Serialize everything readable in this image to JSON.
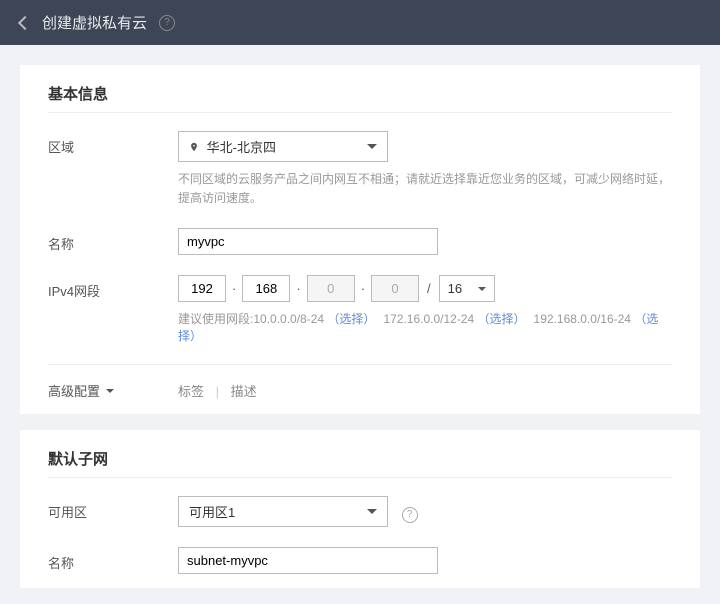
{
  "header": {
    "title": "创建虚拟私有云"
  },
  "basic": {
    "section_title": "基本信息",
    "region": {
      "label": "区域",
      "value": "华北-北京四",
      "hint": "不同区域的云服务产品之间内网互不相通；请就近选择靠近您业务的区域，可减少网络时延，提高访问速度。"
    },
    "name": {
      "label": "名称",
      "value": "myvpc"
    },
    "ipv4": {
      "label": "IPv4网段",
      "octet1": "192",
      "octet2": "168",
      "octet3": "0",
      "octet4": "0",
      "cidr": "16",
      "hint_prefix": "建议使用网段:",
      "ranges": [
        {
          "text": "10.0.0.0/8-24",
          "link": "（选择）"
        },
        {
          "text": "172.16.0.0/12-24",
          "link": "（选择）"
        },
        {
          "text": "192.168.0.0/16-24",
          "link": "（选择）"
        }
      ]
    },
    "adv": {
      "label": "高级配置",
      "item1": "标签",
      "item2": "描述"
    }
  },
  "subnet": {
    "section_title": "默认子网",
    "az": {
      "label": "可用区",
      "value": "可用区1"
    },
    "name": {
      "label": "名称",
      "value": "subnet-myvpc"
    }
  }
}
